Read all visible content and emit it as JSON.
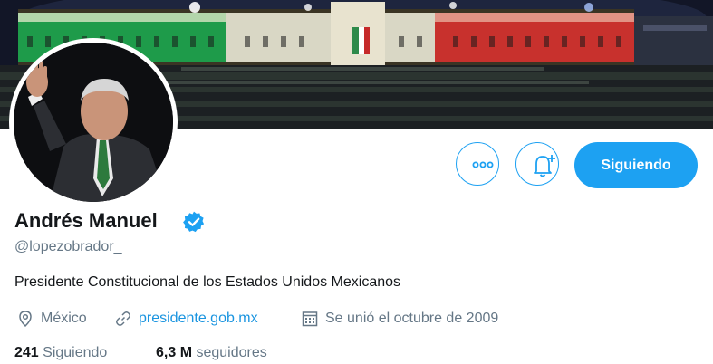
{
  "profile": {
    "name": "Andrés Manuel",
    "handle": "@lopezobrador_",
    "bio": "Presidente Constitucional de los Estados Unidos Mexicanos",
    "location": "México",
    "website": "presidente.gob.mx",
    "joined": "Se unió el octubre de 2009",
    "verified": true
  },
  "actions": {
    "follow_label": "Siguiendo",
    "more_icon": "more-icon",
    "notifications_icon": "bell-plus-icon"
  },
  "stats": {
    "following_count": "241",
    "following_label": "Siguiendo",
    "followers_count": "6,3 M",
    "followers_label": "seguidores"
  },
  "colors": {
    "accent": "#1da1f2",
    "link": "#1b95e0",
    "muted": "#657786",
    "text": "#14171a"
  }
}
